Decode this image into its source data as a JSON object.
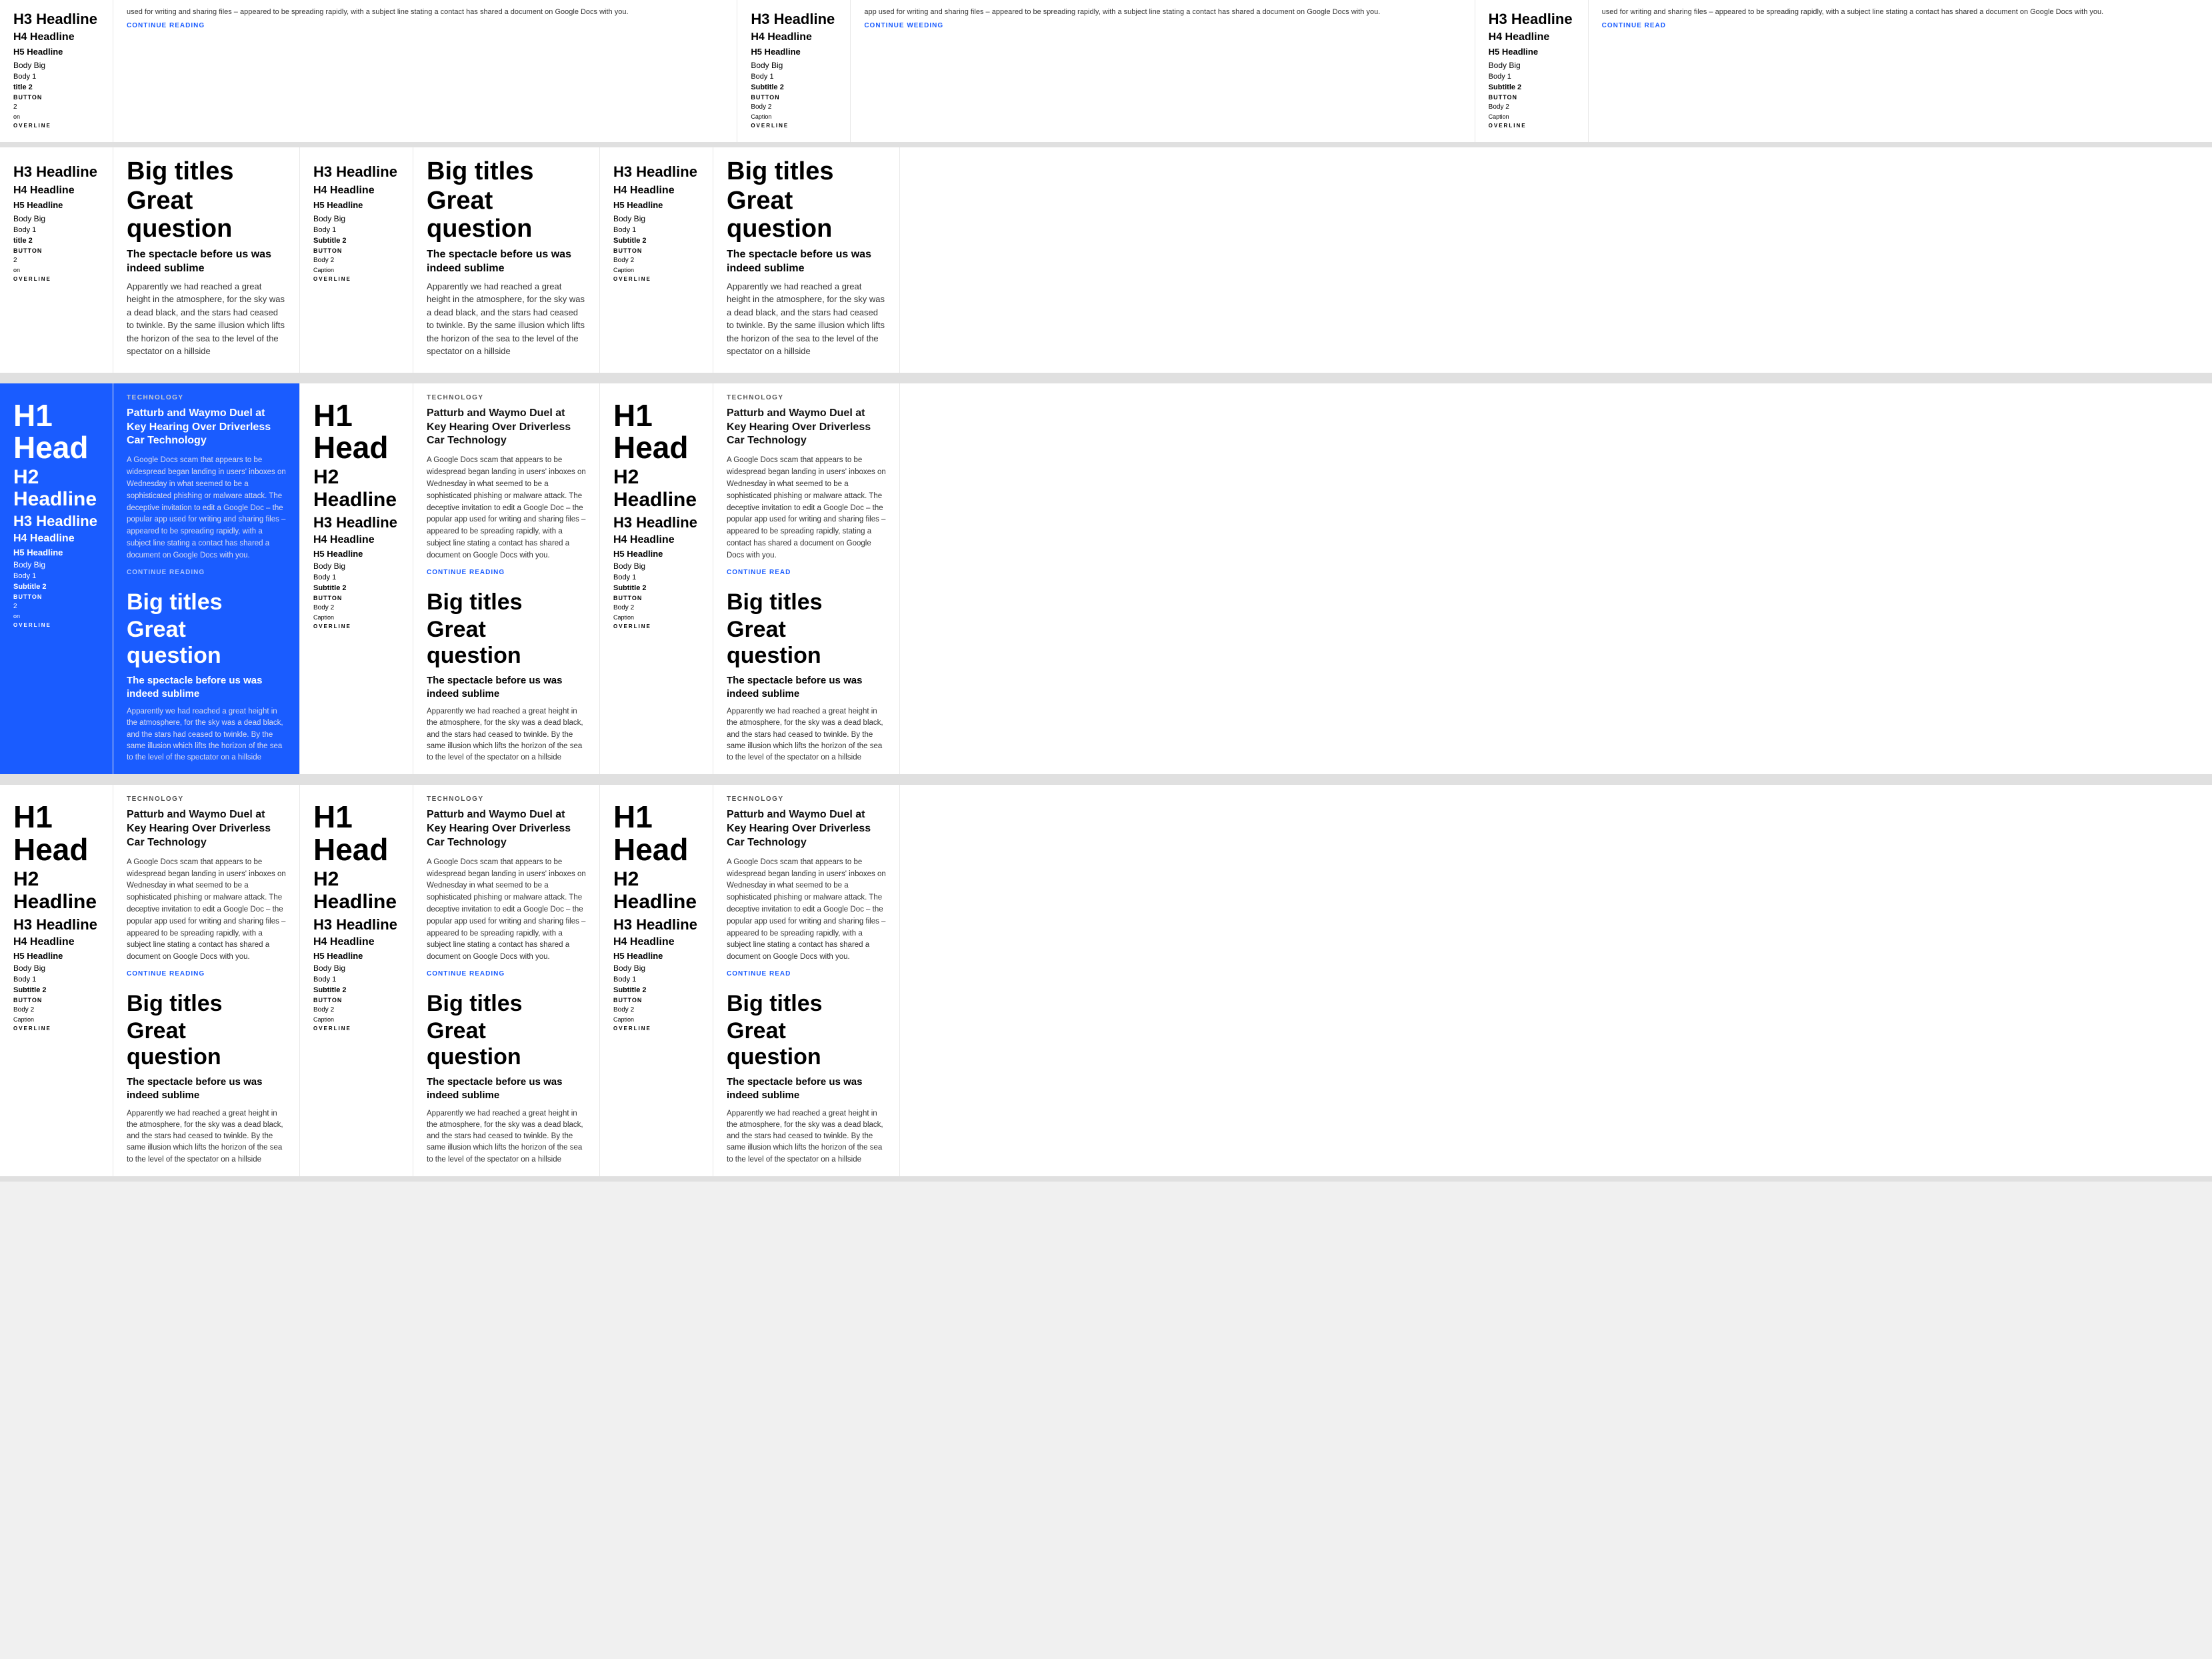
{
  "colors": {
    "blue": "#1a5cff",
    "lightBlue": "#aac4ff",
    "text": "#111",
    "muted": "#555",
    "bg": "#f0f0f0",
    "border": "#e0e0e0"
  },
  "typography": {
    "h1": "H1 Head",
    "h2": "H2 Headline",
    "h3": "H3 Headline",
    "h4": "H4 Headline",
    "h5": "H5 Headline",
    "h3_small": "H3 Headline",
    "h4_small": "H4 Headline",
    "h5_small": "H5 Headline",
    "bigTitles": "Big titles",
    "greatQuestion": "Great question",
    "spectacle": "The spectacle before us was indeed sublime",
    "spectacle2": "The spectacle before us was indeed sublime",
    "bodyBig": "Body Big",
    "body1": "Body 1",
    "subtitle2": "Subtitle 2",
    "button": "BUTTON",
    "body2": "Body 2",
    "caption": "Caption",
    "overline": "OVERLINE",
    "subtitle": "Subtitle",
    "title2": "title 2"
  },
  "article": {
    "techLabel": "TECHNOLOGY",
    "title": "Patturb and Waymo Duel at Key Hearing Over Driverless Car Technology",
    "body": "A Google Docs scam that appears to be widespread began landing in users' inboxes on Wednesday in what seemed to be a sophisticated phishing or malware attack. The deceptive invitation to edit a Google Doc – the popular app used for writing and sharing files – appeared to be spreading rapidly, with a subject line stating a contact has shared a document on Google Docs with you.",
    "continueReading": "CONTINUE READING",
    "continueWeeding": "CONTINUE WEEDING"
  },
  "topArticle": {
    "body": "used for writing and sharing files – appeared to be spreading rapidly, with a subject line stating a contact has shared a document on Google Docs with you.",
    "continueReading": "CONTINUE READING",
    "continueWeeding": "CONTINUE WEEDING",
    "continueRead2": "CONTINUE READ"
  },
  "bodyParagraph": "Apparently we had reached a great height in the atmosphere, for the sky was a dead black, and the stars had ceased to twinkle. By the same illusion which lifts the horizon of the sea to the level of the spectator on a hillside",
  "bodyParagraph2": "Apparently we had reached a great height in the atmosphere, for the sky was a dead black, and the stars had ceased to twinkle. By the same illusion which lifts the horizon of the sea to the level of the spectator on a hillside"
}
